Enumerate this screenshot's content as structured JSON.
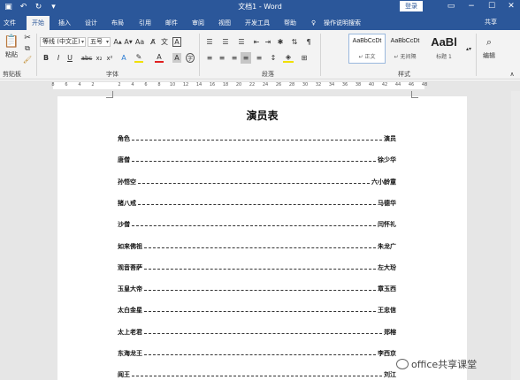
{
  "window": {
    "title": "文档1 - Word",
    "login": "登录",
    "share": "共享"
  },
  "tabs": [
    "文件",
    "开始",
    "插入",
    "设计",
    "布局",
    "引用",
    "邮件",
    "审阅",
    "视图",
    "开发工具",
    "帮助"
  ],
  "active_tab": "开始",
  "tell_me": "操作说明搜索",
  "ribbon": {
    "clipboard": {
      "paste": "粘贴",
      "label": "剪贴板"
    },
    "font": {
      "name": "等线 (中文正)",
      "size": "五号",
      "label": "字体"
    },
    "paragraph": {
      "label": "段落"
    },
    "styles": {
      "label": "样式",
      "items": [
        {
          "sample": "AaBbCcDt",
          "name": "↵ 正文"
        },
        {
          "sample": "AaBbCcDt",
          "name": "↵ 无间隔"
        },
        {
          "sample": "AaBl",
          "name": "标题 1"
        }
      ]
    },
    "editing": {
      "label": "编辑"
    }
  },
  "ruler": [
    "8",
    "6",
    "4",
    "2",
    "",
    "2",
    "4",
    "6",
    "8",
    "10",
    "12",
    "14",
    "16",
    "18",
    "20",
    "22",
    "24",
    "26",
    "28",
    "30",
    "32",
    "34",
    "36",
    "38",
    "40",
    "42",
    "44",
    "46",
    "48"
  ],
  "document": {
    "title": "演员表",
    "rows": [
      {
        "role": "角色",
        "actor": "演员"
      },
      {
        "role": "唐僧",
        "actor": "徐少华"
      },
      {
        "role": "孙悟空",
        "actor": "六小龄童"
      },
      {
        "role": "猪八戒",
        "actor": "马德华"
      },
      {
        "role": "沙僧",
        "actor": "闫怀礼"
      },
      {
        "role": "如来佛祖",
        "actor": "朱龙广"
      },
      {
        "role": "观音菩萨",
        "actor": "左大玢"
      },
      {
        "role": "玉皇大帝",
        "actor": "章玉西"
      },
      {
        "role": "太白金星",
        "actor": "王忠信"
      },
      {
        "role": "太上老君",
        "actor": "郑榕"
      },
      {
        "role": "东海龙王",
        "actor": "李西京"
      },
      {
        "role": "阎王",
        "actor": "刘江"
      }
    ]
  },
  "watermark": "office共享课堂"
}
